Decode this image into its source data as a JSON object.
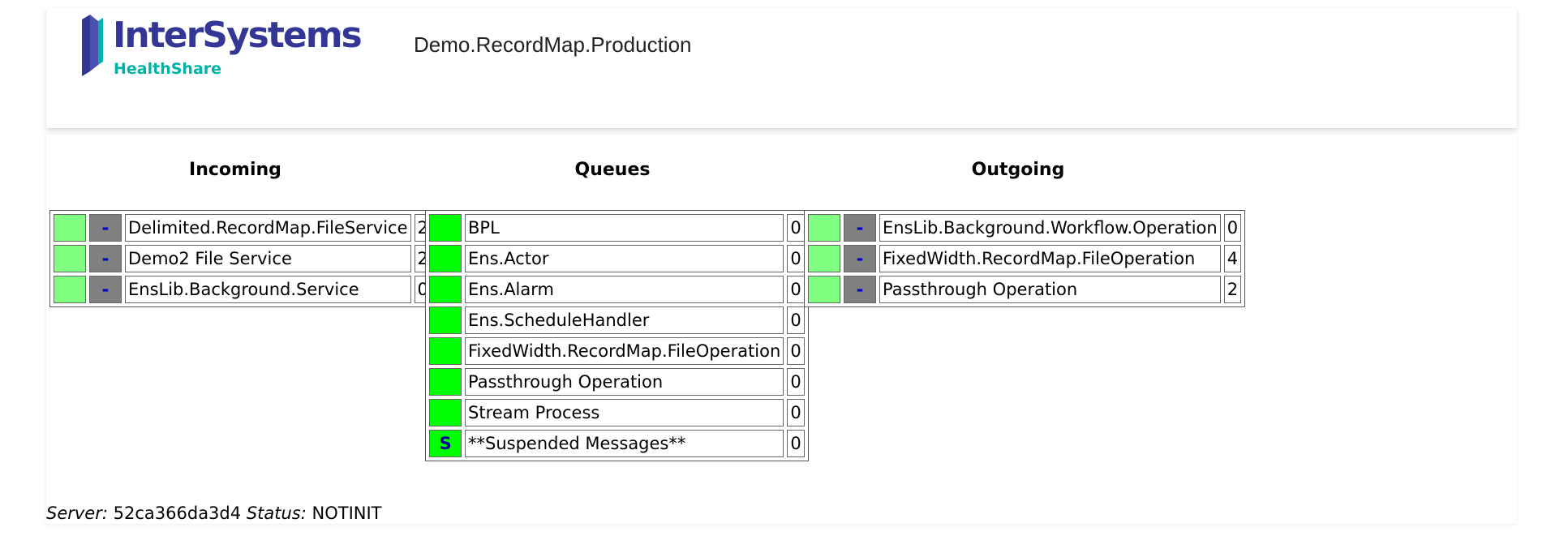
{
  "header": {
    "logo_brand": "InterSystems",
    "logo_sub": "HealthShare",
    "production_name": "Demo.RecordMap.Production"
  },
  "columns": {
    "incoming": "Incoming",
    "queues": "Queues",
    "outgoing": "Outgoing"
  },
  "incoming": [
    {
      "status": "-",
      "name": "Delimited.RecordMap.FileService",
      "count": "2"
    },
    {
      "status": "-",
      "name": "Demo2 File Service",
      "count": "2"
    },
    {
      "status": "-",
      "name": "EnsLib.Background.Service",
      "count": "0"
    }
  ],
  "queues": [
    {
      "flag": "",
      "name": "BPL",
      "count": "0"
    },
    {
      "flag": "",
      "name": "Ens.Actor",
      "count": "0"
    },
    {
      "flag": "",
      "name": "Ens.Alarm",
      "count": "0"
    },
    {
      "flag": "",
      "name": "Ens.ScheduleHandler",
      "count": "0"
    },
    {
      "flag": "",
      "name": "FixedWidth.RecordMap.FileOperation",
      "count": "0"
    },
    {
      "flag": "",
      "name": "Passthrough Operation",
      "count": "0"
    },
    {
      "flag": "",
      "name": "Stream Process",
      "count": "0"
    },
    {
      "flag": "S",
      "name": "**Suspended Messages**",
      "count": "0"
    }
  ],
  "outgoing": [
    {
      "status": "-",
      "name": "EnsLib.Background.Workflow.Operation",
      "count": "0"
    },
    {
      "status": "-",
      "name": "FixedWidth.RecordMap.FileOperation",
      "count": "4"
    },
    {
      "status": "-",
      "name": "Passthrough Operation",
      "count": "2"
    }
  ],
  "footer": {
    "server_label": "Server:",
    "server_value": "52ca366da3d4",
    "status_label": "Status:",
    "status_value": "NOTINIT"
  },
  "colors": {
    "ok_light": "#80ff80",
    "ok_bright": "#00ff00",
    "disabled_gray": "#808080",
    "brand_blue": "#333695",
    "brand_teal": "#00b2a9"
  }
}
